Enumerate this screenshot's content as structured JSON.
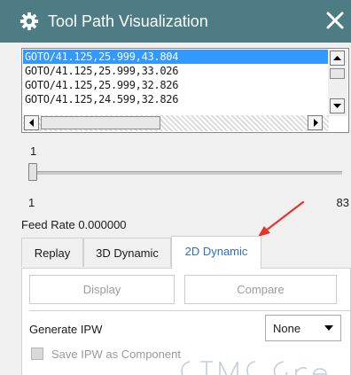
{
  "window": {
    "title": "Tool Path Visualization"
  },
  "listbox": {
    "items": [
      "GOTO/41.125,25.999,43.804",
      "GOTO/41.125,25.999,33.026",
      "GOTO/41.125,25.999,32.826",
      "GOTO/41.125,24.599,32.826"
    ],
    "selected_index": 0
  },
  "slider": {
    "value": "1",
    "min": "1",
    "max": "83"
  },
  "feed_rate": "Feed Rate 0.000000",
  "tabs": [
    {
      "label": "Replay",
      "active": false
    },
    {
      "label": "3D Dynamic",
      "active": false
    },
    {
      "label": "2D Dynamic",
      "active": true
    }
  ],
  "panel": {
    "display_label": "Display",
    "compare_label": "Compare",
    "generate_ipw_label": "Generate IPW",
    "generate_ipw_value": "None",
    "save_ipw_label": "Save IPW as Component",
    "save_ipw_checked": false
  },
  "colors": {
    "titlebar": "#4d7c85",
    "selection": "#3399ff",
    "active_tab_text": "#2e6fc0",
    "annotation_arrow": "#e8322e"
  },
  "icons": {
    "title_icon": "gear-icon",
    "close_icon": "close-icon"
  }
}
